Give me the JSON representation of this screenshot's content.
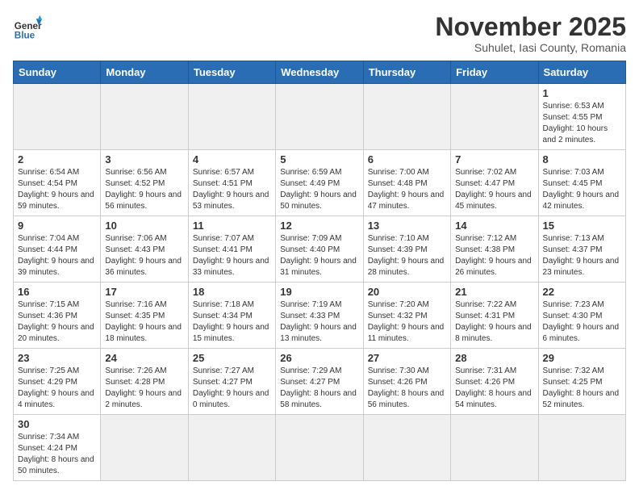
{
  "logo": {
    "general": "General",
    "blue": "Blue"
  },
  "header": {
    "title": "November 2025",
    "subtitle": "Suhulet, Iasi County, Romania"
  },
  "weekdays": [
    "Sunday",
    "Monday",
    "Tuesday",
    "Wednesday",
    "Thursday",
    "Friday",
    "Saturday"
  ],
  "days": [
    {
      "num": "",
      "info": ""
    },
    {
      "num": "",
      "info": ""
    },
    {
      "num": "",
      "info": ""
    },
    {
      "num": "",
      "info": ""
    },
    {
      "num": "",
      "info": ""
    },
    {
      "num": "",
      "info": ""
    },
    {
      "num": "1",
      "info": "Sunrise: 6:53 AM\nSunset: 4:55 PM\nDaylight: 10 hours and 2 minutes."
    },
    {
      "num": "2",
      "info": "Sunrise: 6:54 AM\nSunset: 4:54 PM\nDaylight: 9 hours and 59 minutes."
    },
    {
      "num": "3",
      "info": "Sunrise: 6:56 AM\nSunset: 4:52 PM\nDaylight: 9 hours and 56 minutes."
    },
    {
      "num": "4",
      "info": "Sunrise: 6:57 AM\nSunset: 4:51 PM\nDaylight: 9 hours and 53 minutes."
    },
    {
      "num": "5",
      "info": "Sunrise: 6:59 AM\nSunset: 4:49 PM\nDaylight: 9 hours and 50 minutes."
    },
    {
      "num": "6",
      "info": "Sunrise: 7:00 AM\nSunset: 4:48 PM\nDaylight: 9 hours and 47 minutes."
    },
    {
      "num": "7",
      "info": "Sunrise: 7:02 AM\nSunset: 4:47 PM\nDaylight: 9 hours and 45 minutes."
    },
    {
      "num": "8",
      "info": "Sunrise: 7:03 AM\nSunset: 4:45 PM\nDaylight: 9 hours and 42 minutes."
    },
    {
      "num": "9",
      "info": "Sunrise: 7:04 AM\nSunset: 4:44 PM\nDaylight: 9 hours and 39 minutes."
    },
    {
      "num": "10",
      "info": "Sunrise: 7:06 AM\nSunset: 4:43 PM\nDaylight: 9 hours and 36 minutes."
    },
    {
      "num": "11",
      "info": "Sunrise: 7:07 AM\nSunset: 4:41 PM\nDaylight: 9 hours and 33 minutes."
    },
    {
      "num": "12",
      "info": "Sunrise: 7:09 AM\nSunset: 4:40 PM\nDaylight: 9 hours and 31 minutes."
    },
    {
      "num": "13",
      "info": "Sunrise: 7:10 AM\nSunset: 4:39 PM\nDaylight: 9 hours and 28 minutes."
    },
    {
      "num": "14",
      "info": "Sunrise: 7:12 AM\nSunset: 4:38 PM\nDaylight: 9 hours and 26 minutes."
    },
    {
      "num": "15",
      "info": "Sunrise: 7:13 AM\nSunset: 4:37 PM\nDaylight: 9 hours and 23 minutes."
    },
    {
      "num": "16",
      "info": "Sunrise: 7:15 AM\nSunset: 4:36 PM\nDaylight: 9 hours and 20 minutes."
    },
    {
      "num": "17",
      "info": "Sunrise: 7:16 AM\nSunset: 4:35 PM\nDaylight: 9 hours and 18 minutes."
    },
    {
      "num": "18",
      "info": "Sunrise: 7:18 AM\nSunset: 4:34 PM\nDaylight: 9 hours and 15 minutes."
    },
    {
      "num": "19",
      "info": "Sunrise: 7:19 AM\nSunset: 4:33 PM\nDaylight: 9 hours and 13 minutes."
    },
    {
      "num": "20",
      "info": "Sunrise: 7:20 AM\nSunset: 4:32 PM\nDaylight: 9 hours and 11 minutes."
    },
    {
      "num": "21",
      "info": "Sunrise: 7:22 AM\nSunset: 4:31 PM\nDaylight: 9 hours and 8 minutes."
    },
    {
      "num": "22",
      "info": "Sunrise: 7:23 AM\nSunset: 4:30 PM\nDaylight: 9 hours and 6 minutes."
    },
    {
      "num": "23",
      "info": "Sunrise: 7:25 AM\nSunset: 4:29 PM\nDaylight: 9 hours and 4 minutes."
    },
    {
      "num": "24",
      "info": "Sunrise: 7:26 AM\nSunset: 4:28 PM\nDaylight: 9 hours and 2 minutes."
    },
    {
      "num": "25",
      "info": "Sunrise: 7:27 AM\nSunset: 4:27 PM\nDaylight: 9 hours and 0 minutes."
    },
    {
      "num": "26",
      "info": "Sunrise: 7:29 AM\nSunset: 4:27 PM\nDaylight: 8 hours and 58 minutes."
    },
    {
      "num": "27",
      "info": "Sunrise: 7:30 AM\nSunset: 4:26 PM\nDaylight: 8 hours and 56 minutes."
    },
    {
      "num": "28",
      "info": "Sunrise: 7:31 AM\nSunset: 4:26 PM\nDaylight: 8 hours and 54 minutes."
    },
    {
      "num": "29",
      "info": "Sunrise: 7:32 AM\nSunset: 4:25 PM\nDaylight: 8 hours and 52 minutes."
    },
    {
      "num": "30",
      "info": "Sunrise: 7:34 AM\nSunset: 4:24 PM\nDaylight: 8 hours and 50 minutes."
    },
    {
      "num": "",
      "info": ""
    },
    {
      "num": "",
      "info": ""
    },
    {
      "num": "",
      "info": ""
    },
    {
      "num": "",
      "info": ""
    },
    {
      "num": "",
      "info": ""
    },
    {
      "num": "",
      "info": ""
    }
  ]
}
